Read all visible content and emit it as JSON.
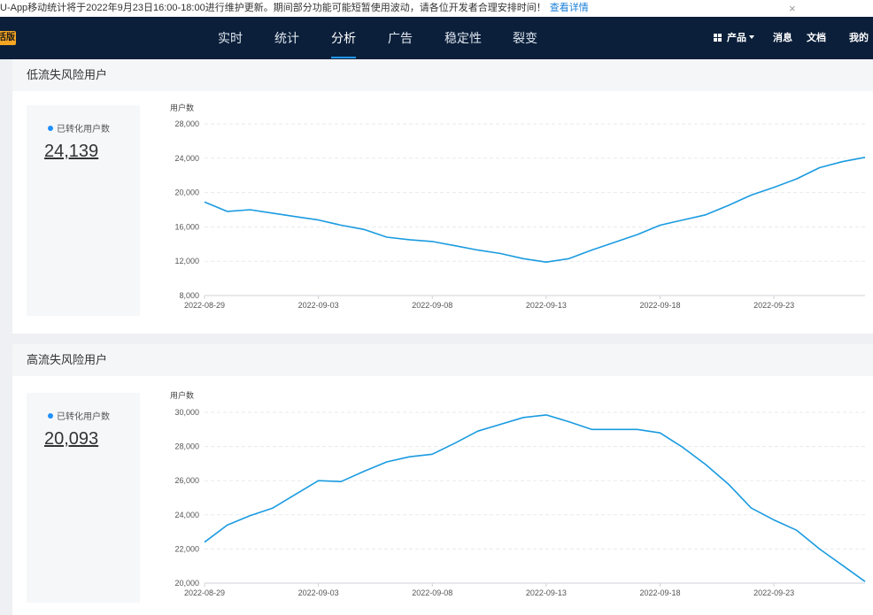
{
  "notice": {
    "text": "U-App移动统计将于2022年9月23日16:00-18:00进行维护更新。期间部分功能可能短暂使用波动，请各位开发者合理安排时间！",
    "link": "查看详情",
    "close": "×"
  },
  "nav": {
    "badge": "活版",
    "tabs": [
      {
        "label": "实时"
      },
      {
        "label": "统计"
      },
      {
        "label": "分析",
        "active": true
      },
      {
        "label": "广告"
      },
      {
        "label": "稳定性"
      },
      {
        "label": "裂变"
      }
    ],
    "right": {
      "product": "产品",
      "messages": "消息",
      "docs": "文档",
      "mine": "我的"
    }
  },
  "panels": [
    {
      "title": "低流失风险用户",
      "stat_label": "已转化用户数",
      "stat_value": "24,139"
    },
    {
      "title": "高流失风险用户",
      "stat_label": "已转化用户数",
      "stat_value": "20,093"
    }
  ],
  "colors": {
    "line": "#1a9be0",
    "nav_bg": "#0b1f3a",
    "accent": "#2196f3"
  },
  "chart_data": [
    {
      "type": "line",
      "ylabel": "用户数",
      "ylim": [
        8000,
        28000
      ],
      "yticks": [
        8000,
        12000,
        16000,
        20000,
        24000,
        28000
      ],
      "ytick_labels": [
        "8,000",
        "12,000",
        "16,000",
        "20,000",
        "24,000",
        "28,000"
      ],
      "xtick_labels": [
        "2022-08-29",
        "2022-09-03",
        "2022-09-08",
        "2022-09-13",
        "2022-09-18",
        "2022-09-23"
      ],
      "x_start": "2022-08-29",
      "x_end": "2022-09-27",
      "grid": true,
      "series": [
        {
          "values": [
            18900,
            17800,
            18000,
            17600,
            17200,
            16800,
            16200,
            15700,
            14800,
            14500,
            14300,
            13800,
            13300,
            12900,
            12300,
            11900,
            12300,
            13300,
            14200,
            15100,
            16200,
            16800,
            17400,
            18500,
            19700,
            20600,
            21600,
            22900,
            23600,
            24100
          ]
        }
      ]
    },
    {
      "type": "line",
      "ylabel": "用户数",
      "ylim": [
        20000,
        30000
      ],
      "yticks": [
        20000,
        22000,
        24000,
        26000,
        28000,
        30000
      ],
      "ytick_labels": [
        "20,000",
        "22,000",
        "24,000",
        "26,000",
        "28,000",
        "30,000"
      ],
      "xtick_labels": [
        "2022-08-29",
        "2022-09-03",
        "2022-09-08",
        "2022-09-13",
        "2022-09-18",
        "2022-09-23"
      ],
      "x_start": "2022-08-29",
      "x_end": "2022-09-27",
      "grid": true,
      "series": [
        {
          "values": [
            22400,
            23400,
            23950,
            24400,
            25200,
            26000,
            25950,
            26550,
            27100,
            27400,
            27550,
            28200,
            28900,
            29300,
            29700,
            29850,
            29450,
            29000,
            29000,
            29000,
            28800,
            27950,
            26950,
            25800,
            24400,
            23700,
            23100,
            22000,
            21050,
            20093
          ]
        }
      ]
    }
  ]
}
